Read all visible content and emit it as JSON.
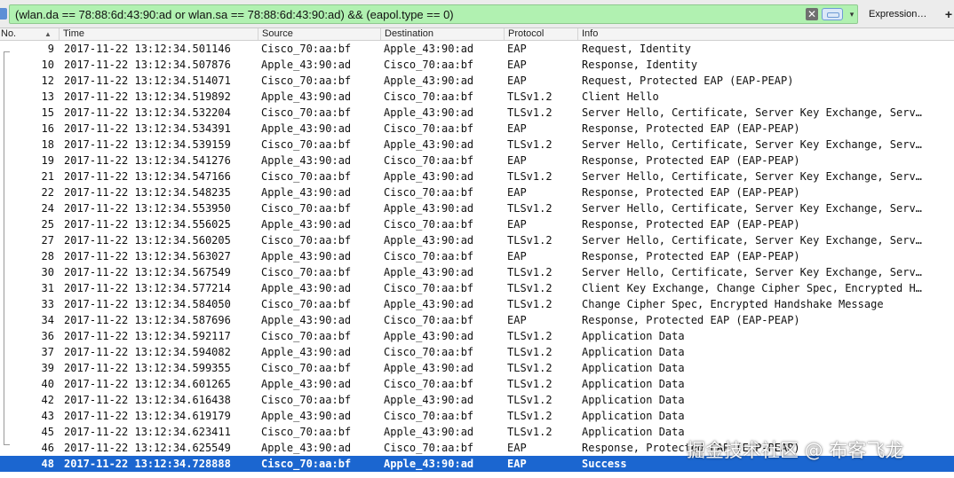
{
  "filter": {
    "text": "(wlan.da == 78:88:6d:43:90:ad or wlan.sa == 78:88:6d:43:90:ad) && (eapol.type == 0)",
    "clear_glyph": "✕",
    "dropdown_glyph": "▾",
    "expression_label": "Expression…",
    "add_label": "+",
    "bg_color": "#b1f1b1"
  },
  "columns": {
    "no": "No.",
    "time": "Time",
    "source": "Source",
    "destination": "Destination",
    "protocol": "Protocol",
    "info": "Info",
    "sort_glyph": "▲"
  },
  "packets": [
    {
      "no": "9",
      "time": "2017-11-22 13:12:34.501146",
      "src": "Cisco_70:aa:bf",
      "dst": "Apple_43:90:ad",
      "proto": "EAP",
      "info": "Request, Identity"
    },
    {
      "no": "10",
      "time": "2017-11-22 13:12:34.507876",
      "src": "Apple_43:90:ad",
      "dst": "Cisco_70:aa:bf",
      "proto": "EAP",
      "info": "Response, Identity"
    },
    {
      "no": "12",
      "time": "2017-11-22 13:12:34.514071",
      "src": "Cisco_70:aa:bf",
      "dst": "Apple_43:90:ad",
      "proto": "EAP",
      "info": "Request, Protected EAP (EAP-PEAP)"
    },
    {
      "no": "13",
      "time": "2017-11-22 13:12:34.519892",
      "src": "Apple_43:90:ad",
      "dst": "Cisco_70:aa:bf",
      "proto": "TLSv1.2",
      "info": "Client Hello"
    },
    {
      "no": "15",
      "time": "2017-11-22 13:12:34.532204",
      "src": "Cisco_70:aa:bf",
      "dst": "Apple_43:90:ad",
      "proto": "TLSv1.2",
      "info": "Server Hello, Certificate, Server Key Exchange, Serv…"
    },
    {
      "no": "16",
      "time": "2017-11-22 13:12:34.534391",
      "src": "Apple_43:90:ad",
      "dst": "Cisco_70:aa:bf",
      "proto": "EAP",
      "info": "Response, Protected EAP (EAP-PEAP)"
    },
    {
      "no": "18",
      "time": "2017-11-22 13:12:34.539159",
      "src": "Cisco_70:aa:bf",
      "dst": "Apple_43:90:ad",
      "proto": "TLSv1.2",
      "info": "Server Hello, Certificate, Server Key Exchange, Serv…"
    },
    {
      "no": "19",
      "time": "2017-11-22 13:12:34.541276",
      "src": "Apple_43:90:ad",
      "dst": "Cisco_70:aa:bf",
      "proto": "EAP",
      "info": "Response, Protected EAP (EAP-PEAP)"
    },
    {
      "no": "21",
      "time": "2017-11-22 13:12:34.547166",
      "src": "Cisco_70:aa:bf",
      "dst": "Apple_43:90:ad",
      "proto": "TLSv1.2",
      "info": "Server Hello, Certificate, Server Key Exchange, Serv…"
    },
    {
      "no": "22",
      "time": "2017-11-22 13:12:34.548235",
      "src": "Apple_43:90:ad",
      "dst": "Cisco_70:aa:bf",
      "proto": "EAP",
      "info": "Response, Protected EAP (EAP-PEAP)"
    },
    {
      "no": "24",
      "time": "2017-11-22 13:12:34.553950",
      "src": "Cisco_70:aa:bf",
      "dst": "Apple_43:90:ad",
      "proto": "TLSv1.2",
      "info": "Server Hello, Certificate, Server Key Exchange, Serv…"
    },
    {
      "no": "25",
      "time": "2017-11-22 13:12:34.556025",
      "src": "Apple_43:90:ad",
      "dst": "Cisco_70:aa:bf",
      "proto": "EAP",
      "info": "Response, Protected EAP (EAP-PEAP)"
    },
    {
      "no": "27",
      "time": "2017-11-22 13:12:34.560205",
      "src": "Cisco_70:aa:bf",
      "dst": "Apple_43:90:ad",
      "proto": "TLSv1.2",
      "info": "Server Hello, Certificate, Server Key Exchange, Serv…"
    },
    {
      "no": "28",
      "time": "2017-11-22 13:12:34.563027",
      "src": "Apple_43:90:ad",
      "dst": "Cisco_70:aa:bf",
      "proto": "EAP",
      "info": "Response, Protected EAP (EAP-PEAP)"
    },
    {
      "no": "30",
      "time": "2017-11-22 13:12:34.567549",
      "src": "Cisco_70:aa:bf",
      "dst": "Apple_43:90:ad",
      "proto": "TLSv1.2",
      "info": "Server Hello, Certificate, Server Key Exchange, Serv…"
    },
    {
      "no": "31",
      "time": "2017-11-22 13:12:34.577214",
      "src": "Apple_43:90:ad",
      "dst": "Cisco_70:aa:bf",
      "proto": "TLSv1.2",
      "info": "Client Key Exchange, Change Cipher Spec, Encrypted H…"
    },
    {
      "no": "33",
      "time": "2017-11-22 13:12:34.584050",
      "src": "Cisco_70:aa:bf",
      "dst": "Apple_43:90:ad",
      "proto": "TLSv1.2",
      "info": "Change Cipher Spec, Encrypted Handshake Message"
    },
    {
      "no": "34",
      "time": "2017-11-22 13:12:34.587696",
      "src": "Apple_43:90:ad",
      "dst": "Cisco_70:aa:bf",
      "proto": "EAP",
      "info": "Response, Protected EAP (EAP-PEAP)"
    },
    {
      "no": "36",
      "time": "2017-11-22 13:12:34.592117",
      "src": "Cisco_70:aa:bf",
      "dst": "Apple_43:90:ad",
      "proto": "TLSv1.2",
      "info": "Application Data"
    },
    {
      "no": "37",
      "time": "2017-11-22 13:12:34.594082",
      "src": "Apple_43:90:ad",
      "dst": "Cisco_70:aa:bf",
      "proto": "TLSv1.2",
      "info": "Application Data"
    },
    {
      "no": "39",
      "time": "2017-11-22 13:12:34.599355",
      "src": "Cisco_70:aa:bf",
      "dst": "Apple_43:90:ad",
      "proto": "TLSv1.2",
      "info": "Application Data"
    },
    {
      "no": "40",
      "time": "2017-11-22 13:12:34.601265",
      "src": "Apple_43:90:ad",
      "dst": "Cisco_70:aa:bf",
      "proto": "TLSv1.2",
      "info": "Application Data"
    },
    {
      "no": "42",
      "time": "2017-11-22 13:12:34.616438",
      "src": "Cisco_70:aa:bf",
      "dst": "Apple_43:90:ad",
      "proto": "TLSv1.2",
      "info": "Application Data"
    },
    {
      "no": "43",
      "time": "2017-11-22 13:12:34.619179",
      "src": "Apple_43:90:ad",
      "dst": "Cisco_70:aa:bf",
      "proto": "TLSv1.2",
      "info": "Application Data"
    },
    {
      "no": "45",
      "time": "2017-11-22 13:12:34.623411",
      "src": "Cisco_70:aa:bf",
      "dst": "Apple_43:90:ad",
      "proto": "TLSv1.2",
      "info": "Application Data"
    },
    {
      "no": "46",
      "time": "2017-11-22 13:12:34.625549",
      "src": "Apple_43:90:ad",
      "dst": "Cisco_70:aa:bf",
      "proto": "EAP",
      "info": "Response, Protected EAP (EAP-PEAP)"
    },
    {
      "no": "48",
      "time": "2017-11-22 13:12:34.728888",
      "src": "Cisco_70:aa:bf",
      "dst": "Apple_43:90:ad",
      "proto": "EAP",
      "info": "Success",
      "selected": true
    }
  ],
  "watermark": "掘金技术社区 @ 布客飞龙",
  "selection_color": "#1b66d0"
}
